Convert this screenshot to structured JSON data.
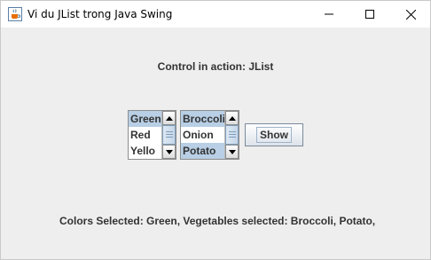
{
  "window": {
    "title": "Vi du JList trong Java Swing",
    "icon": "java-cup-icon",
    "controls": [
      "minimize-icon",
      "maximize-icon",
      "close-icon"
    ]
  },
  "heading": "Control in action: JList",
  "colors_list": {
    "items": [
      {
        "label": "Green",
        "selected": true
      },
      {
        "label": "Red",
        "selected": false
      },
      {
        "label": "Yello",
        "selected": false
      }
    ]
  },
  "vegetables_list": {
    "items": [
      {
        "label": "Broccoli",
        "selected": true
      },
      {
        "label": "Onion",
        "selected": false
      },
      {
        "label": "Potato",
        "selected": true
      }
    ]
  },
  "show_button": {
    "label": "Show"
  },
  "status": "Colors Selected: Green, Vegetables selected: Broccoli, Potato,",
  "colors": {
    "selection": "#b8cfe5",
    "text": "#333333",
    "background": "#eeeeee"
  }
}
